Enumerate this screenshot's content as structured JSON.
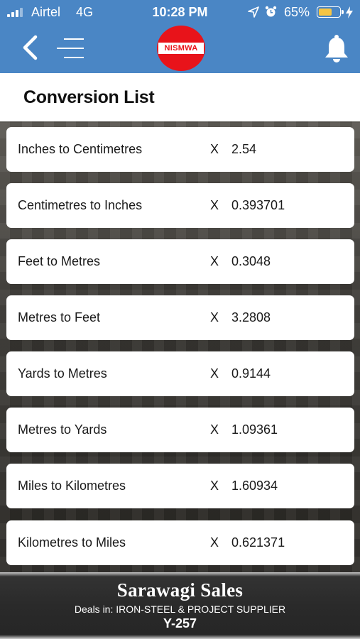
{
  "status_bar": {
    "carrier": "Airtel",
    "network": "4G",
    "time": "10:28 PM",
    "battery_percent": "65%",
    "battery_level": 0.65,
    "icons": [
      "signal-bars-icon",
      "location-arrow-icon",
      "alarm-clock-icon",
      "battery-icon",
      "charging-bolt-icon"
    ]
  },
  "nav": {
    "logo_text": "NISMWA",
    "icons": [
      "back-chevron-icon",
      "hamburger-menu-icon",
      "bell-icon"
    ],
    "colors": {
      "bar": "#4a86c5",
      "logo": "#e8131a"
    }
  },
  "page": {
    "title": "Conversion List"
  },
  "conversions": [
    {
      "label": "Inches to Centimetres",
      "op": "X",
      "factor": "2.54"
    },
    {
      "label": "Centimetres to Inches",
      "op": "X",
      "factor": "0.393701"
    },
    {
      "label": "Feet to Metres",
      "op": "X",
      "factor": "0.3048"
    },
    {
      "label": "Metres to Feet",
      "op": "X",
      "factor": "3.2808"
    },
    {
      "label": "Yards to Metres",
      "op": "X",
      "factor": "0.9144"
    },
    {
      "label": "Metres to Yards",
      "op": "X",
      "factor": "1.09361"
    },
    {
      "label": "Miles to Kilometres",
      "op": "X",
      "factor": "1.60934"
    },
    {
      "label": "Kilometres to Miles",
      "op": "X",
      "factor": "0.621371"
    }
  ],
  "footer_ad": {
    "brand": "Sarawagi Sales",
    "tagline": "Deals in: IRON-STEEL & PROJECT SUPPLIER",
    "code": "Y-257"
  }
}
